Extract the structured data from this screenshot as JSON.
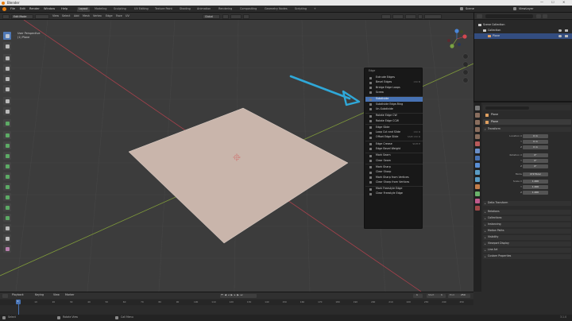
{
  "window": {
    "title": "Blender",
    "controls": [
      "—",
      "☐",
      "✕"
    ]
  },
  "menu": {
    "items": [
      "File",
      "Edit",
      "Render",
      "Window",
      "Help"
    ]
  },
  "workspaces": {
    "items": [
      "Layout",
      "Modeling",
      "Sculpting",
      "UV Editing",
      "Texture Paint",
      "Shading",
      "Animation",
      "Rendering",
      "Compositing",
      "Geometry Nodes",
      "Scripting"
    ],
    "active": 0,
    "plus": "+"
  },
  "scene": {
    "label": "Scene",
    "layer_label": "ViewLayer"
  },
  "header": {
    "mode": "Edit Mode",
    "items": [
      "View",
      "Select",
      "Add",
      "Mesh",
      "Vertex",
      "Edge",
      "Face",
      "UV"
    ],
    "orientation": "Global",
    "options": "Options"
  },
  "viewport": {
    "view_name": "User Perspective",
    "object_name": "(1) Plane"
  },
  "context_menu": {
    "title": "Edge",
    "items": [
      {
        "label": "Extrude Edges",
        "shortcut": ""
      },
      {
        "label": "Bevel Edges",
        "shortcut": "Ctrl B"
      },
      {
        "label": "Bridge Edge Loops",
        "shortcut": ""
      },
      {
        "label": "Screw",
        "shortcut": ""
      },
      {
        "sep": true
      },
      {
        "label": "Subdivide",
        "shortcut": "",
        "highlight": true
      },
      {
        "label": "Subdivide Edge-Ring",
        "shortcut": ""
      },
      {
        "label": "Un-Subdivide",
        "shortcut": ""
      },
      {
        "sep": true
      },
      {
        "label": "Rotate Edge CW",
        "shortcut": ""
      },
      {
        "label": "Rotate Edge CCW",
        "shortcut": ""
      },
      {
        "sep": true
      },
      {
        "label": "Edge Slide",
        "shortcut": ""
      },
      {
        "label": "Loop Cut and Slide",
        "shortcut": "Ctrl R"
      },
      {
        "label": "Offset Edge Slide",
        "shortcut": "Shift Ctrl R"
      },
      {
        "sep": true
      },
      {
        "label": "Edge Crease",
        "shortcut": "Shift E"
      },
      {
        "label": "Edge Bevel Weight",
        "shortcut": ""
      },
      {
        "sep": true
      },
      {
        "label": "Mark Seam",
        "shortcut": ""
      },
      {
        "label": "Clear Seam",
        "shortcut": ""
      },
      {
        "sep": true
      },
      {
        "label": "Mark Sharp",
        "shortcut": ""
      },
      {
        "label": "Clear Sharp",
        "shortcut": ""
      },
      {
        "label": "Mark Sharp from Vertices",
        "shortcut": ""
      },
      {
        "label": "Clear Sharp from Vertices",
        "shortcut": ""
      },
      {
        "sep": true
      },
      {
        "label": "Mark Freestyle Edge",
        "shortcut": ""
      },
      {
        "label": "Clear Freestyle Edge",
        "shortcut": ""
      }
    ]
  },
  "outliner": {
    "search_placeholder": "",
    "rows": [
      {
        "label": "Scene Collection",
        "indent": 0,
        "selected": false
      },
      {
        "label": "Collection",
        "indent": 1,
        "selected": false
      },
      {
        "label": "Plane",
        "indent": 2,
        "selected": true
      }
    ]
  },
  "properties": {
    "object_name": "Plane",
    "data_name": "Plane",
    "transform_header": "Transform",
    "location_label": "Location X",
    "location": [
      {
        "axis": "X",
        "value": "0 m"
      },
      {
        "axis": "Y",
        "value": "0 m"
      },
      {
        "axis": "Z",
        "value": "0 m"
      }
    ],
    "rotation_label": "Rotation X",
    "rotation": [
      {
        "axis": "X",
        "value": "0°"
      },
      {
        "axis": "Y",
        "value": "0°"
      },
      {
        "axis": "Z",
        "value": "0°"
      }
    ],
    "mode_label": "Mode",
    "mode_value": "XYZ Euler",
    "scale_label": "Scale X",
    "scale": [
      {
        "axis": "X",
        "value": "1.000"
      },
      {
        "axis": "Y",
        "value": "1.000"
      },
      {
        "axis": "Z",
        "value": "1.000"
      }
    ],
    "sections": [
      "Delta Transform",
      "Relations",
      "Collections",
      "Instancing",
      "Motion Paths",
      "Visibility",
      "Viewport Display",
      "Line Art",
      "Custom Properties"
    ]
  },
  "timeline": {
    "menu": [
      "Playback",
      "Keying",
      "View",
      "Marker"
    ],
    "frames": [
      "0",
      "10",
      "20",
      "30",
      "40",
      "50",
      "60",
      "70",
      "80",
      "90",
      "100",
      "110",
      "120",
      "130",
      "140",
      "150",
      "160",
      "170",
      "180",
      "190",
      "200",
      "210",
      "220",
      "230",
      "240",
      "250"
    ],
    "current_frame": "1",
    "start_label": "Start",
    "start": "1",
    "end_label": "End",
    "end": "250"
  },
  "statusbar": {
    "left": "Select",
    "middle": "Rotate View",
    "right": "Call Menu",
    "version": "3.1.0"
  },
  "colors": {
    "accent": "#4772b3",
    "arrow": "#2fa8d8",
    "plane": "#c9b5ab",
    "x_axis": "#a6414c",
    "y_axis": "#7f9a3a"
  }
}
